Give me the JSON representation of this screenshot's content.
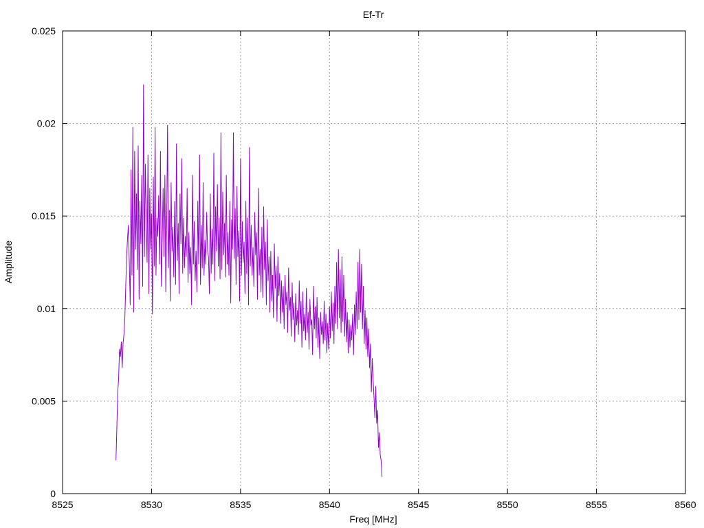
{
  "chart_data": {
    "type": "line",
    "title": "Ef-Tr",
    "xlabel": "Freq [MHz]",
    "ylabel": "Amplitude",
    "xlim": [
      8525,
      8560
    ],
    "ylim": [
      0,
      0.025
    ],
    "x_ticks": [
      "8525",
      "8530",
      "8535",
      "8540",
      "8545",
      "8550",
      "8555",
      "8560"
    ],
    "y_ticks": [
      "0",
      "0.005",
      "0.01",
      "0.015",
      "0.02",
      "0.025"
    ],
    "grid": true,
    "series": [
      {
        "color": "#9400d3",
        "x_start": 8528.0,
        "x_step": 0.05,
        "values": [
          0.0018,
          0.0035,
          0.0055,
          0.0062,
          0.0078,
          0.0074,
          0.0082,
          0.0068,
          0.0081,
          0.0086,
          0.0095,
          0.0112,
          0.0128,
          0.0138,
          0.0145,
          0.0125,
          0.0102,
          0.0175,
          0.0118,
          0.0198,
          0.0098,
          0.0185,
          0.0132,
          0.0162,
          0.0121,
          0.0188,
          0.0105,
          0.0158,
          0.0135,
          0.0172,
          0.0112,
          0.0221,
          0.0128,
          0.0178,
          0.0148,
          0.0125,
          0.0183,
          0.0108,
          0.0165,
          0.0132,
          0.0151,
          0.0097,
          0.0171,
          0.0123,
          0.0198,
          0.0118,
          0.0149,
          0.0139,
          0.0161,
          0.0124,
          0.0185,
          0.0112,
          0.0137,
          0.0165,
          0.0128,
          0.0172,
          0.0109,
          0.0145,
          0.0199,
          0.0122,
          0.0153,
          0.0104,
          0.0168,
          0.0131,
          0.0144,
          0.0117,
          0.0158,
          0.0113,
          0.0189,
          0.0126,
          0.0146,
          0.0108,
          0.0162,
          0.0135,
          0.0181,
          0.0119,
          0.0149,
          0.0122,
          0.0139,
          0.0128,
          0.0165,
          0.0114,
          0.0141,
          0.0119,
          0.0133,
          0.0102,
          0.0172,
          0.0124,
          0.0147,
          0.0115,
          0.0131,
          0.0109,
          0.0158,
          0.0124,
          0.0183,
          0.0113,
          0.0145,
          0.0122,
          0.0168,
          0.0118,
          0.0137,
          0.0124,
          0.0152,
          0.0131,
          0.0128,
          0.0108,
          0.0162,
          0.0119,
          0.0143,
          0.0124,
          0.0184,
          0.0115,
          0.0155,
          0.0131,
          0.0167,
          0.0123,
          0.0149,
          0.0116,
          0.0195,
          0.0121,
          0.0163,
          0.0129,
          0.0146,
          0.0117,
          0.0172,
          0.0124,
          0.0141,
          0.0118,
          0.0158,
          0.0103,
          0.0148,
          0.0132,
          0.0195,
          0.0127,
          0.0154,
          0.0113,
          0.0166,
          0.0128,
          0.0142,
          0.0104,
          0.0181,
          0.0118,
          0.0147,
          0.0125,
          0.0136,
          0.0108,
          0.0158,
          0.0119,
          0.0149,
          0.0102,
          0.0187,
          0.0123,
          0.0145,
          0.0118,
          0.0133,
          0.0112,
          0.0152,
          0.0129,
          0.0141,
          0.0105,
          0.0165,
          0.0118,
          0.0132,
          0.0109,
          0.0144,
          0.0106,
          0.0155,
          0.0121,
          0.0136,
          0.0102,
          0.0148,
          0.0115,
          0.0128,
          0.0098,
          0.0131,
          0.0104,
          0.0118,
          0.0095,
          0.0135,
          0.0111,
          0.0123,
          0.0093,
          0.0128,
          0.0107,
          0.0119,
          0.0092,
          0.0115,
          0.0098,
          0.0112,
          0.0089,
          0.0118,
          0.0102,
          0.0109,
          0.0087,
          0.0122,
          0.0099,
          0.0106,
          0.0085,
          0.0114,
          0.0094,
          0.0103,
          0.0082,
          0.0108,
          0.0091,
          0.0099,
          0.0086,
          0.0115,
          0.0092,
          0.0104,
          0.0079,
          0.0109,
          0.0088,
          0.0097,
          0.0083,
          0.0111,
          0.0087,
          0.0098,
          0.0078,
          0.0105,
          0.0091,
          0.0094,
          0.0075,
          0.0112,
          0.0089,
          0.0101,
          0.0084,
          0.0106,
          0.0079,
          0.0095,
          0.0073,
          0.0098,
          0.0086,
          0.0093,
          0.0081,
          0.0104,
          0.0083,
          0.0097,
          0.0076,
          0.0092,
          0.0078,
          0.0101,
          0.0084,
          0.0109,
          0.0088,
          0.0103,
          0.0081,
          0.0112,
          0.0092,
          0.0125,
          0.0089,
          0.0132,
          0.0095,
          0.0121,
          0.0087,
          0.0128,
          0.0093,
          0.0118,
          0.0085,
          0.0105,
          0.0082,
          0.0098,
          0.0076,
          0.0094,
          0.0079,
          0.0091,
          0.0083,
          0.0097,
          0.0075,
          0.0102,
          0.0086,
          0.0109,
          0.0089,
          0.0125,
          0.0094,
          0.0132,
          0.0098,
          0.0124,
          0.0089,
          0.0112,
          0.0081,
          0.0099,
          0.0078,
          0.0095,
          0.0074,
          0.0089,
          0.0068,
          0.0081,
          0.0055,
          0.0073,
          0.0062,
          0.0052,
          0.0041,
          0.0058,
          0.0038,
          0.0045,
          0.0025,
          0.0033,
          0.0021,
          0.0018,
          0.0009
        ]
      }
    ]
  }
}
